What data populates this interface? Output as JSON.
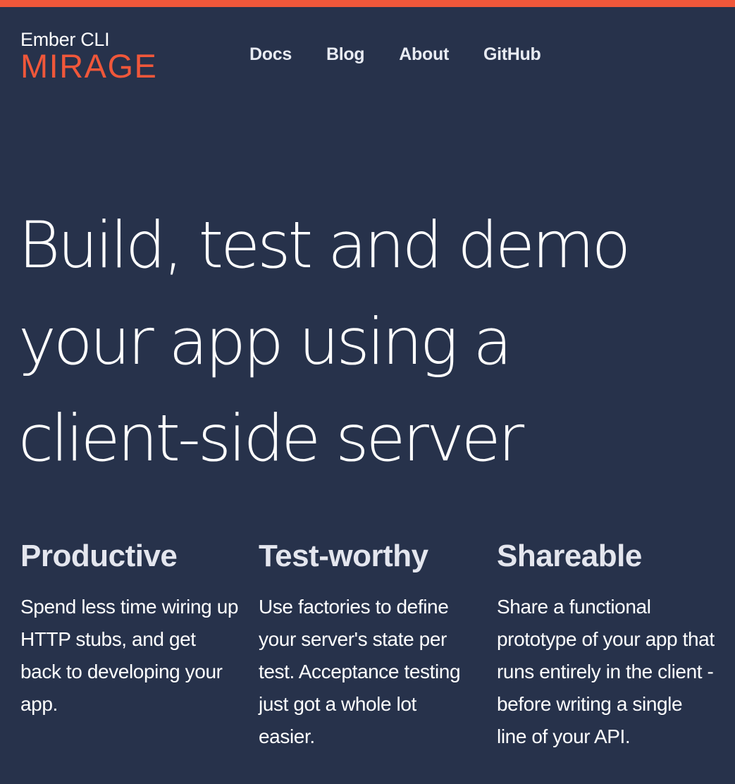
{
  "brand": {
    "line1": "Ember CLI",
    "line2": "MIRAGE",
    "accent_color": "#f0573a",
    "background_color": "#27324b"
  },
  "nav": {
    "items": [
      {
        "label": "Docs"
      },
      {
        "label": "Blog"
      },
      {
        "label": "About"
      },
      {
        "label": "GitHub"
      }
    ]
  },
  "hero": {
    "lines": [
      "Build, test and demo",
      "your app using a",
      "client-side server"
    ]
  },
  "features": [
    {
      "title": "Productive",
      "text": "Spend less time wiring up HTTP stubs, and get back to developing your app."
    },
    {
      "title": "Test-worthy",
      "text": "Use factories to define your server's state per test. Acceptance testing just got a whole lot easier."
    },
    {
      "title": "Shareable",
      "text": "Share a functional prototype of your app that runs entirely in the client - before writing a single line of your API."
    }
  ]
}
